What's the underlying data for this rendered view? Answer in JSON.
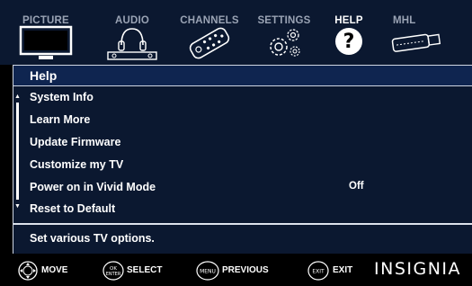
{
  "tabs": [
    {
      "label": "PICTURE",
      "icon": "tv-icon"
    },
    {
      "label": "AUDIO",
      "icon": "headphones-icon"
    },
    {
      "label": "CHANNELS",
      "icon": "remote-icon"
    },
    {
      "label": "SETTINGS",
      "icon": "gears-icon"
    },
    {
      "label": "HELP",
      "icon": "help-icon"
    },
    {
      "label": "MHL",
      "icon": "mhl-icon"
    }
  ],
  "active_tab": "HELP",
  "panel": {
    "title": "Help",
    "items": [
      {
        "label": "System Info",
        "value": ""
      },
      {
        "label": "Learn More",
        "value": ""
      },
      {
        "label": "Update Firmware",
        "value": ""
      },
      {
        "label": "Customize my TV",
        "value": ""
      },
      {
        "label": "Power on in Vivid Mode",
        "value": "Off"
      },
      {
        "label": "Reset to Default",
        "value": ""
      }
    ],
    "description": "Set various TV options."
  },
  "footer": {
    "move": "MOVE",
    "ok_icon_top": "OK",
    "ok_icon_bottom": "ENTER",
    "select": "SELECT",
    "menu_icon": "MENU",
    "previous": "PREVIOUS",
    "exit_icon": "EXIT",
    "exit": "EXIT",
    "brand": "INSIGNIA"
  },
  "colors": {
    "background": "#0b1830",
    "header": "#0f2550",
    "text": "#ffffff",
    "inactive_tab": "#9aa3b4"
  }
}
